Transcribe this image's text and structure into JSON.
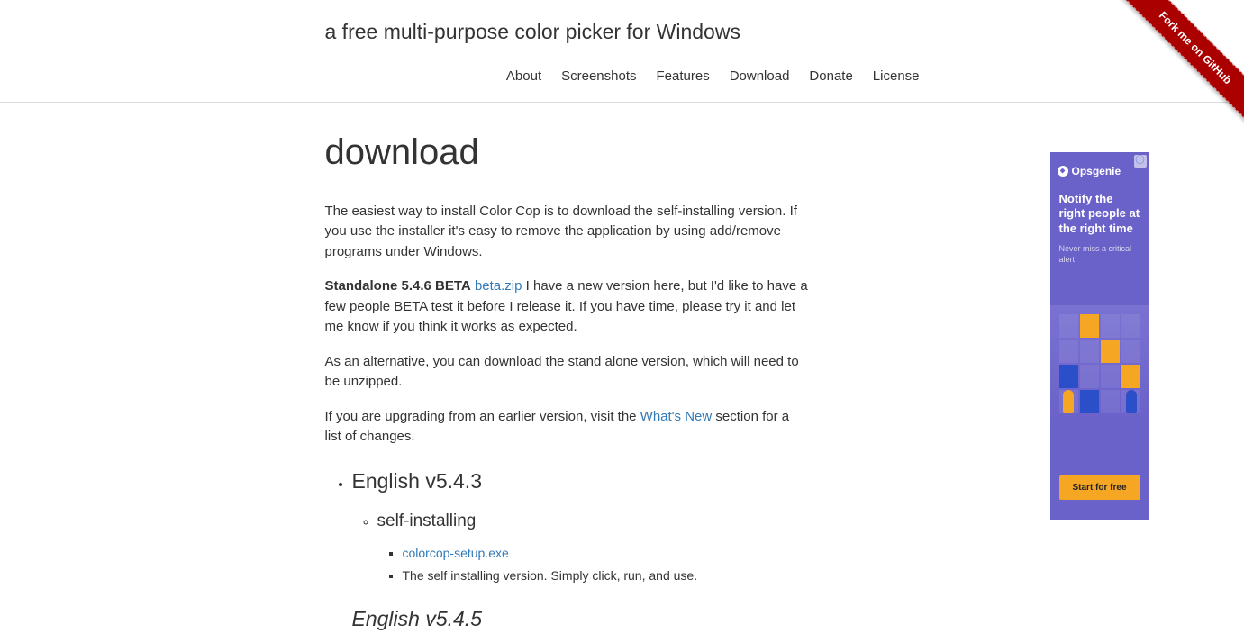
{
  "header": {
    "tagline": "a free multi-purpose color picker for Windows"
  },
  "nav": {
    "items": [
      "About",
      "Screenshots",
      "Features",
      "Download",
      "Donate",
      "License"
    ]
  },
  "page": {
    "title": "download",
    "intro": "The easiest way to install Color Cop is to download the self-installing version. If you use the installer it's easy to remove the application by using add/remove programs under Windows.",
    "beta_label": "Standalone 5.4.6 BETA",
    "beta_link": "beta.zip",
    "beta_text": " I have a new version here, but I'd like to have a few people BETA test it before I release it. If you have time, please try it and let me know if you think it works as expected.",
    "alt_text": "As an alternative, you can download the stand alone version, which will need to be unzipped.",
    "upgrade_pre": "If you are upgrading from an earlier version, visit the ",
    "upgrade_link": "What's New",
    "upgrade_post": " section for a list of changes.",
    "downloads": [
      {
        "heading": "English v5.4.3",
        "groups": [
          {
            "heading": "self-installing",
            "items": [
              {
                "link": "colorcop-setup.exe",
                "is_link": true
              },
              {
                "text": "The self installing version. Simply click, run, and use."
              }
            ]
          }
        ]
      }
    ],
    "next_heading": "English v5.4.5"
  },
  "ad": {
    "brand": "Opsgenie",
    "headline": "Notify the right people at the right time",
    "sub": "Never miss a critical alert",
    "cta": "Start for free",
    "info": "ⓘ"
  },
  "ribbon": {
    "label": "Fork me on GitHub"
  }
}
